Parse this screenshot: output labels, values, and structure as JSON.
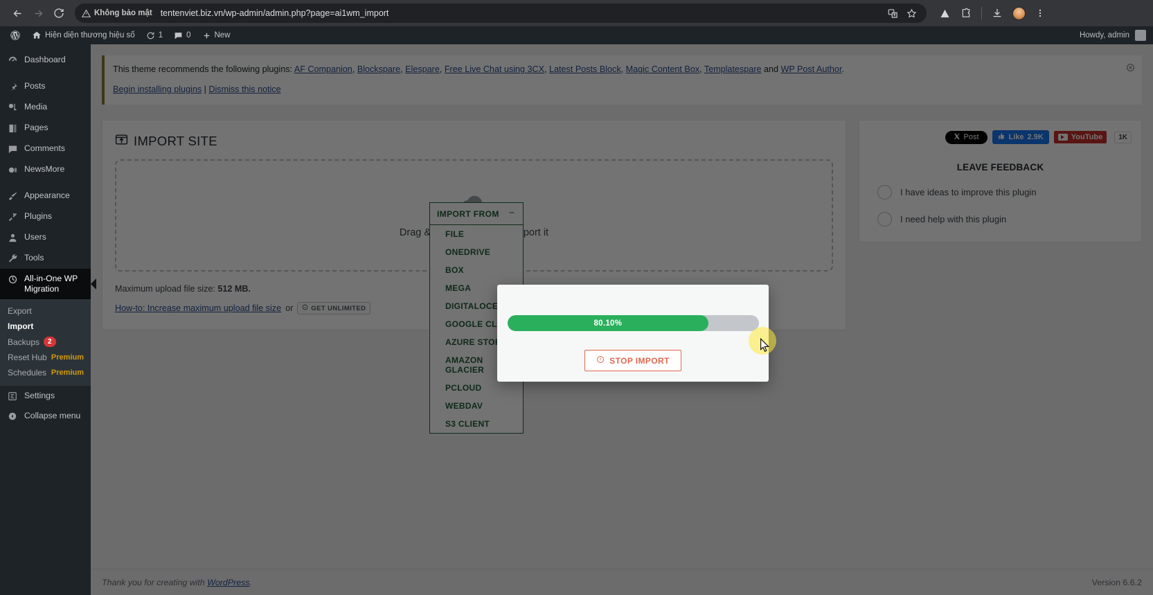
{
  "browser": {
    "security_label": "Không bảo mật",
    "url": "tentenviet.biz.vn/wp-admin/admin.php?page=ai1wm_import",
    "icons": [
      "back-arrow-icon",
      "forward-arrow-icon",
      "reload-icon",
      "translate-icon",
      "bookmark-star-icon",
      "extension-icon",
      "puzzle-icon",
      "download-icon",
      "profile-avatar-icon",
      "kebab-menu-icon"
    ]
  },
  "adminbar": {
    "logo": "wordpress-logo-icon",
    "site_name": "Hiện diện thương hiệu số",
    "updates_count": "1",
    "comments_count": "0",
    "new_label": "New",
    "howdy": "Howdy, admin"
  },
  "sidebar": {
    "items": [
      {
        "label": "Dashboard",
        "icon": "dashboard-icon"
      },
      {
        "label": "Posts",
        "icon": "pin-icon"
      },
      {
        "label": "Media",
        "icon": "media-icon"
      },
      {
        "label": "Pages",
        "icon": "pages-icon"
      },
      {
        "label": "Comments",
        "icon": "comment-icon"
      },
      {
        "label": "NewsMore",
        "icon": "newsmore-icon"
      },
      {
        "label": "Appearance",
        "icon": "brush-icon"
      },
      {
        "label": "Plugins",
        "icon": "plugin-icon"
      },
      {
        "label": "Users",
        "icon": "user-icon"
      },
      {
        "label": "Tools",
        "icon": "wrench-icon"
      },
      {
        "label": "All-in-One WP Migration",
        "icon": "migration-icon"
      }
    ],
    "submenu": [
      {
        "label": "Export",
        "badge": "",
        "tag": ""
      },
      {
        "label": "Import",
        "badge": "",
        "tag": ""
      },
      {
        "label": "Backups",
        "badge": "2",
        "tag": ""
      },
      {
        "label": "Reset Hub",
        "badge": "",
        "tag": "Premium"
      },
      {
        "label": "Schedules",
        "badge": "",
        "tag": "Premium"
      }
    ],
    "settings_label": "Settings",
    "collapse_label": "Collapse menu"
  },
  "notice": {
    "text_prefix": "This theme recommends the following plugins:",
    "plugins": [
      "AF Companion",
      "Blockspare",
      "Elespare",
      "Free Live Chat using 3CX",
      "Latest Posts Block",
      "Magic Content Box",
      "Templatespare",
      "WP Post Author"
    ],
    "conjunction": "and",
    "period": ".",
    "begin_install": "Begin installing plugins",
    "divider": "|",
    "dismiss": "Dismiss this notice",
    "close_icon": "close-circle-icon"
  },
  "import_page": {
    "title": "IMPORT SITE",
    "title_icon": "import-site-icon",
    "dropzone_text": "Drag & Drop a backup to import it",
    "dropzone_icon": "cloud-upload-icon",
    "max_upload_prefix": "Maximum upload file size:",
    "max_upload_value": "512 MB.",
    "howto_link": "How-to: Increase maximum upload file size",
    "howto_or": "or",
    "get_unlimited": "GET UNLIMITED",
    "get_unlimited_icon": "info-circle-icon",
    "import_from_label": "IMPORT FROM",
    "import_from_toggle_icon": "minus-icon",
    "import_sources": [
      "FILE",
      "ONEDRIVE",
      "BOX",
      "MEGA",
      "DIGITALOCEAN",
      "GOOGLE CLOUD",
      "AZURE STORAGE",
      "AMAZON GLACIER",
      "PCLOUD",
      "WEBDAV",
      "S3 CLIENT"
    ]
  },
  "feedback": {
    "x_button": "Post",
    "x_icon": "x-logo-icon",
    "fb_button": "Like",
    "fb_count": "2.9K",
    "fb_icon": "thumbs-up-icon",
    "yt_button": "YouTube",
    "yt_count": "1K",
    "yt_icon": "youtube-play-icon",
    "title": "LEAVE FEEDBACK",
    "options": [
      "I have ideas to improve this plugin",
      "I need help with this plugin"
    ]
  },
  "modal": {
    "progress_percent_label": "80.10%",
    "progress_value": 80.1,
    "stop_button": "STOP IMPORT",
    "stop_icon": "warning-circle-icon"
  },
  "footer": {
    "thanks_prefix": "Thank you for creating with",
    "wordpress_link": "WordPress",
    "period": ".",
    "version": "Version 6.6.2"
  },
  "colors": {
    "accent_green": "#2aaf5d",
    "dark_green": "#24623c",
    "stop_red": "#e0684f",
    "wp_blue": "#2a4b8d",
    "sidebar_bg": "#1d2327"
  }
}
